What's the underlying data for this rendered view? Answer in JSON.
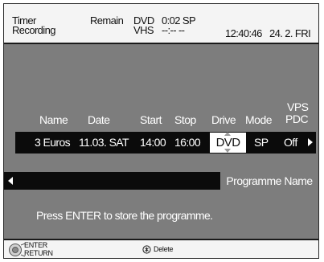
{
  "header": {
    "title_line1": "Timer",
    "title_line2": "Recording",
    "remain_label": "Remain",
    "dvd_label": "DVD",
    "dvd_value": "0:02 SP",
    "vhs_label": "VHS",
    "vhs_value": "--:--  --",
    "time": "12:40:46",
    "date": "24. 2. FRI"
  },
  "columns": {
    "name": "Name",
    "date": "Date",
    "start": "Start",
    "stop": "Stop",
    "drive": "Drive",
    "mode": "Mode",
    "vps_line1": "VPS",
    "vps_line2": "PDC"
  },
  "program_row": {
    "name": "3 Euros",
    "date": "11.03. SAT",
    "start": "14:00",
    "stop": "16:00",
    "drive": "DVD",
    "mode": "SP",
    "vps_pdc": "Off"
  },
  "programme_name_label": "Programme Name",
  "message": "Press ENTER to store the programme.",
  "footer": {
    "enter_label": "ENTER",
    "return_label": "RETURN",
    "delete_label": "Delete"
  },
  "icons": [
    "dial-icon",
    "delete-button-icon",
    "left-arrow-icon",
    "right-arrow-icon",
    "up-arrow-icon",
    "down-arrow-icon"
  ]
}
